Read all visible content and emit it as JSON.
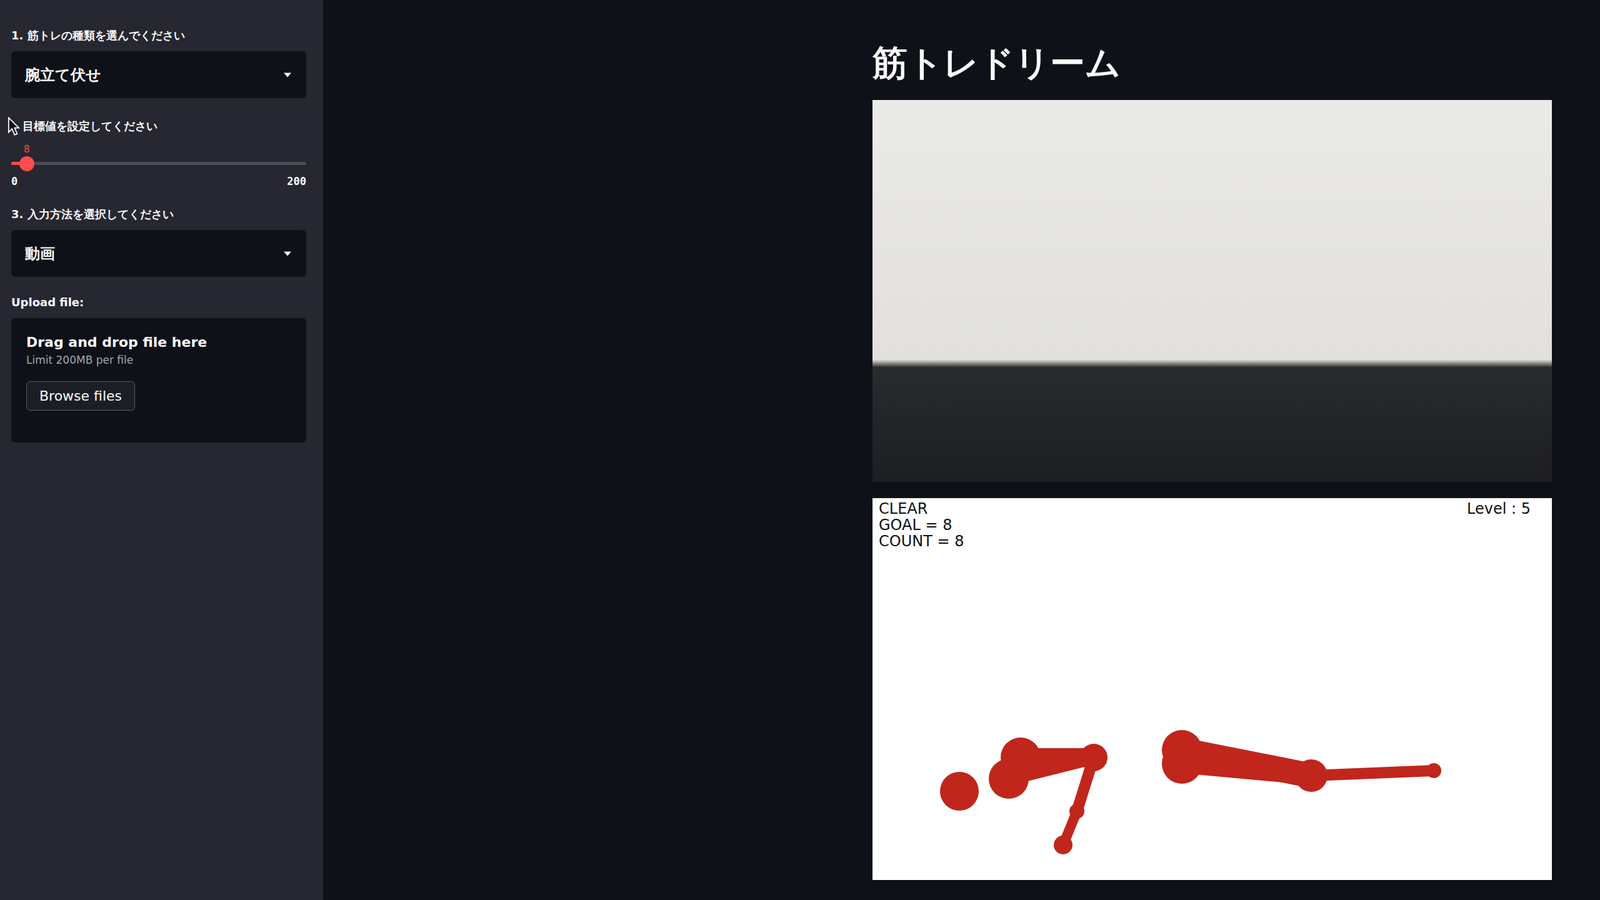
{
  "app": {
    "title": "筋トレドリーム"
  },
  "sidebar": {
    "exercise": {
      "label": "1. 筋トレの種類を選んでください",
      "value": "腕立て伏せ"
    },
    "goal": {
      "label": "目標値を設定してください",
      "value": "8",
      "min": "0",
      "max": "200",
      "level": 0.04
    },
    "input": {
      "label": "3. 入力方法を選択してください",
      "value": "動画"
    },
    "upload": {
      "label": "Upload file:",
      "title": "Drag and drop file here",
      "limit": "Limit 200MB per file",
      "button": "Browse files"
    }
  },
  "result": {
    "status": "CLEAR",
    "goal": "GOAL = 8",
    "count": "COUNT = 8",
    "level_text": "Level : 5"
  }
}
